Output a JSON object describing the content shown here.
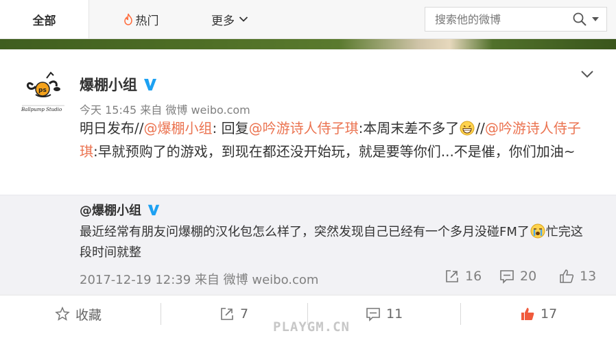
{
  "tabs": {
    "all": "全部",
    "hot": "热门",
    "more": "更多"
  },
  "search": {
    "placeholder": "搜索他的微博"
  },
  "post": {
    "author": "爆棚小组",
    "avatar_text": "Ballpump Studio",
    "time": "今天 15:45",
    "source": "来自 微博 weibo.com",
    "content": {
      "t1": "明日发布//",
      "m1": "@爆棚小组",
      "t2": ": 回复",
      "m2": "@吟游诗人侍子琪",
      "t3": ":本周末差不多了",
      "t4": "//",
      "m3": "@吟游诗人侍子琪",
      "t5": ":早就预购了的游戏，到现在都还没开始玩，就是要等你们...不是催，你们加油~"
    }
  },
  "repost": {
    "author": "@爆棚小组",
    "content_a": "最近经常有朋友问爆棚的汉化包怎么样了，突然发现自己已经有一个多月没碰FM了",
    "content_b": "忙完这段时间就整",
    "time": "2017-12-19 12:39",
    "source": "来自 微博 weibo.com",
    "reposts": "16",
    "comments": "20",
    "likes": "13"
  },
  "actions": {
    "favorite": "收藏",
    "repost": "7",
    "comment": "11",
    "like": "17"
  },
  "watermark": "PLAYGM.CN",
  "colors": {
    "mention": "#eb7350",
    "verified": "#1da1f2",
    "like_active": "#f05a3c",
    "hot_icon": "#ff6a3a"
  },
  "icons": [
    "fire-icon",
    "chevron-down-icon",
    "search-icon",
    "caret-down-icon",
    "verified-badge-icon",
    "grin-emoji-icon",
    "crying-emoji-icon",
    "repost-icon",
    "comment-icon",
    "like-icon",
    "star-icon"
  ]
}
